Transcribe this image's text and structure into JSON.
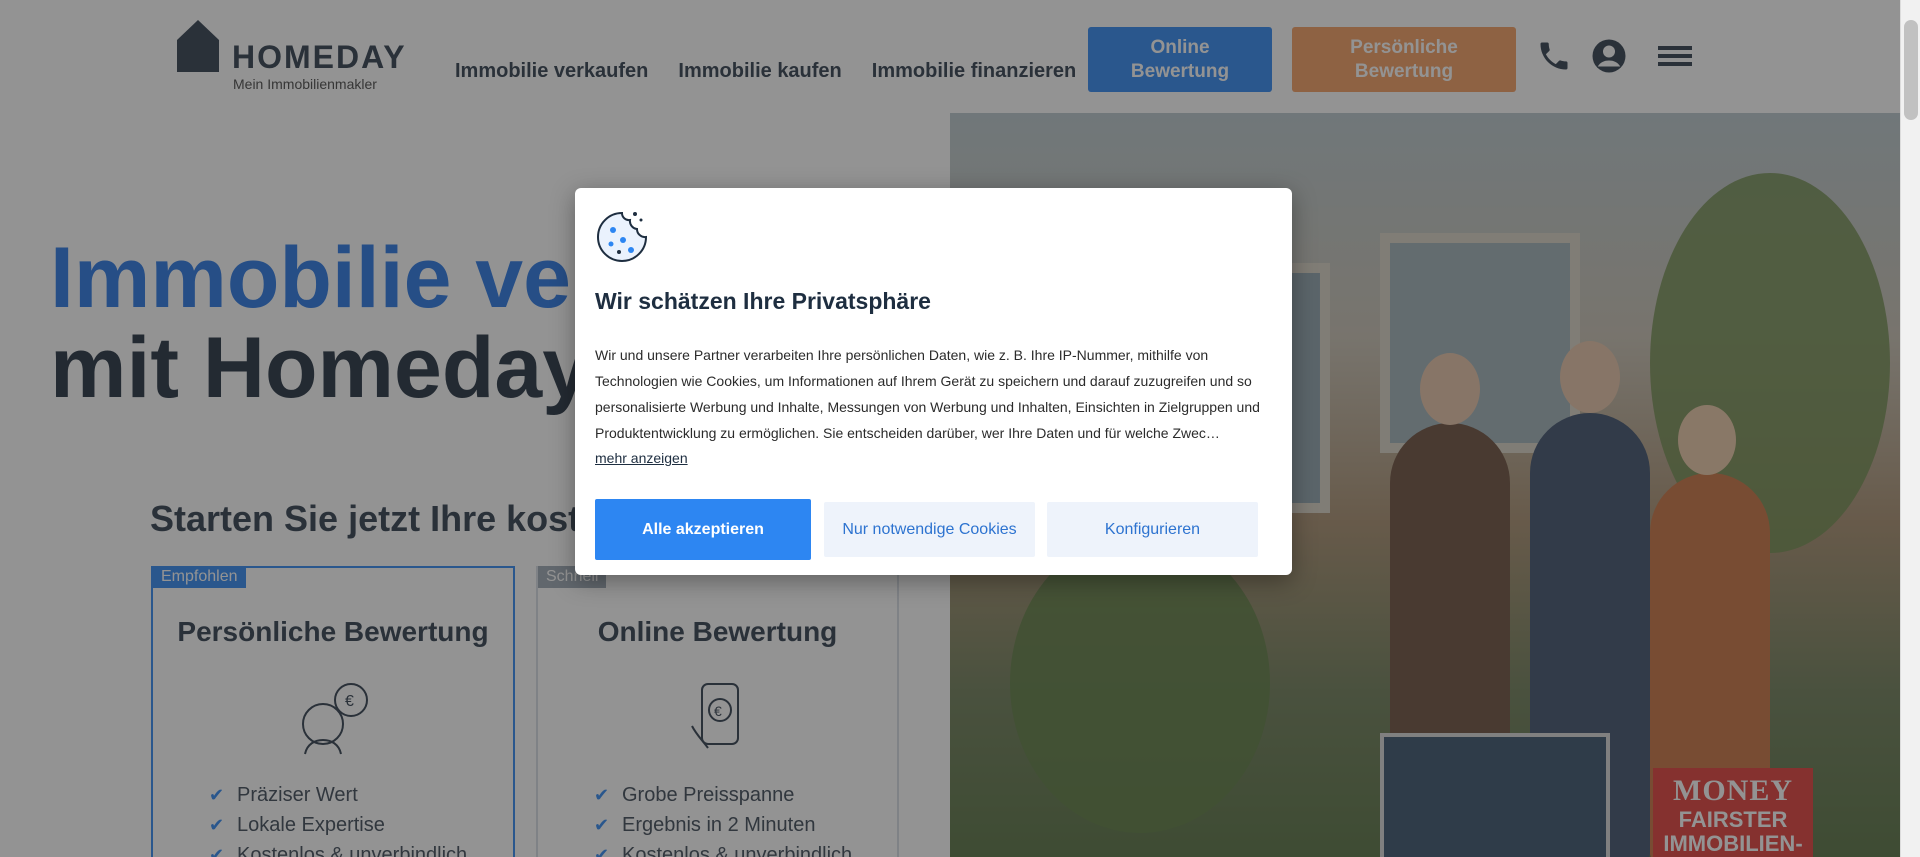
{
  "header": {
    "logo_word": "HOMEDAY",
    "logo_sub": "Mein Immobilienmakler",
    "nav": [
      "Immobilie verkaufen",
      "Immobilie kaufen",
      "Immobilie finanzieren"
    ],
    "online_button": "Online Bewertung",
    "personal_button": "Persönliche Bewertung",
    "icons": [
      "phone-icon",
      "user-account-icon",
      "menu-icon"
    ]
  },
  "hero": {
    "title_line1": "Immobilie verkaufen",
    "title_line2": "mit Homeday",
    "subtitle": "Starten Sie jetzt Ihre kostenfreie Bewertung",
    "cards": [
      {
        "badge": "Empfohlen",
        "title": "Persönliche Bewertung",
        "features": [
          "Präziser Wert",
          "Lokale Expertise",
          "Kostenlos & unverbindlich"
        ]
      },
      {
        "badge": "Schnell",
        "title": "Online Bewertung",
        "features": [
          "Grobe Preisspanne",
          "Ergebnis in 2 Minuten",
          "Kostenlos & unverbindlich"
        ]
      }
    ],
    "badge_money_top": "MONEY",
    "badge_money_bottom": "FAIRSTER IMMOBILIEN-"
  },
  "cookie_modal": {
    "title": "Wir schätzen Ihre Privatsphäre",
    "text": "Wir und unsere Partner verarbeiten Ihre persönlichen Daten, wie z. B. Ihre IP-Nummer, mithilfe von Technologien wie Cookies, um Informationen auf Ihrem Gerät zu speichern und darauf zuzugreifen und so personalisierte Werbung und Inhalte, Messungen von Werbung und Inhalten, Einsichten in Zielgruppen und Produktentwicklung zu ermöglichen. Sie entscheiden darüber, wer Ihre Daten und für welche Zwec…",
    "more_link": "mehr anzeigen",
    "accept_all": "Alle akzeptieren",
    "necessary_only": "Nur notwendige Cookies",
    "configure": "Konfigurieren"
  },
  "colors": {
    "primary_blue": "#2d86f2",
    "accent_orange": "#f59d5e",
    "dark_text": "#1e2e40",
    "overlay": "rgba(40,40,40,0.5)"
  }
}
